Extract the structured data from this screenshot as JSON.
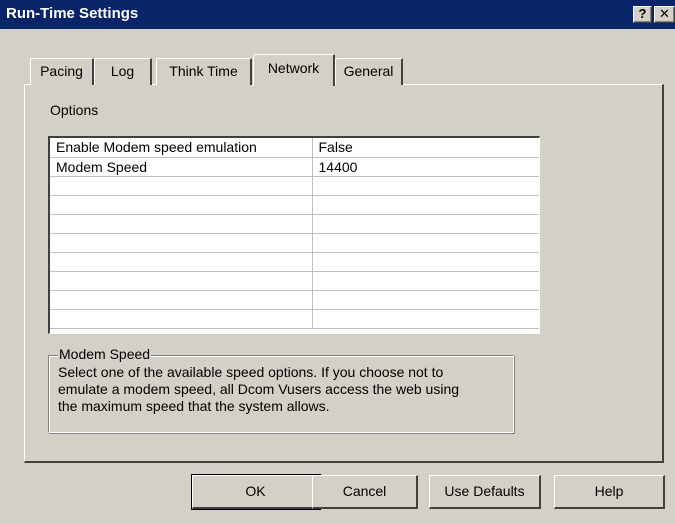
{
  "window": {
    "title": "Run-Time Settings",
    "help_glyph": "?",
    "close_glyph": "✕"
  },
  "tabs": [
    {
      "label": "Pacing",
      "active": false
    },
    {
      "label": "Log",
      "active": false
    },
    {
      "label": "Think Time",
      "active": false
    },
    {
      "label": "Network",
      "active": true
    },
    {
      "label": "General",
      "active": false
    }
  ],
  "options": {
    "label": "Options",
    "rows": [
      {
        "name": "Enable Modem speed emulation",
        "value": "False"
      },
      {
        "name": "Modem Speed",
        "value": "14400"
      },
      {
        "name": "",
        "value": ""
      },
      {
        "name": "",
        "value": ""
      },
      {
        "name": "",
        "value": ""
      },
      {
        "name": "",
        "value": ""
      },
      {
        "name": "",
        "value": ""
      },
      {
        "name": "",
        "value": ""
      },
      {
        "name": "",
        "value": ""
      },
      {
        "name": "",
        "value": ""
      }
    ]
  },
  "description": {
    "title": "Modem Speed",
    "text_line1": "Select one of the available speed options. If you choose not to",
    "text_line2": "emulate a modem speed, all Dcom Vusers access the web using",
    "text_line3": "the maximum speed that the system allows."
  },
  "buttons": {
    "ok": "OK",
    "cancel": "Cancel",
    "use_defaults": "Use Defaults",
    "help": "Help"
  },
  "colors": {
    "titlebar": "#0a246a",
    "face": "#d4d0c8"
  }
}
